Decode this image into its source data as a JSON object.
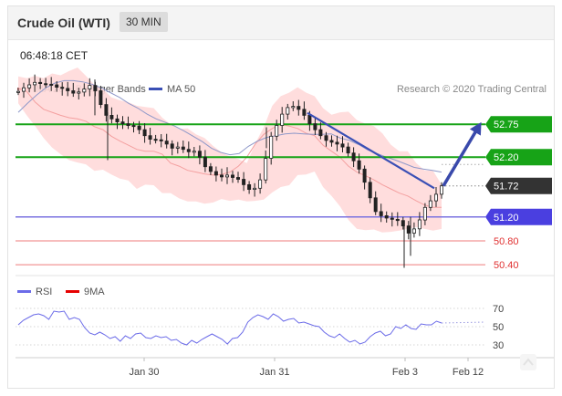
{
  "header": {
    "title": "Crude Oil (WTI)",
    "interval": "30 MIN"
  },
  "timestamp": "06:48:18 CET",
  "legend": {
    "bollinger": "MA 20 + Bollinger Bands",
    "ma50": "MA 50",
    "credit": "Research © 2020 Trading Central",
    "rsi": "RSI",
    "rsi_ma": "9MA"
  },
  "colors": {
    "green": "#17a317",
    "purple": "#4a3fe0",
    "red": "#e64848",
    "navy": "#3a4fb5",
    "band": "#ffd9d9",
    "dark": "#333333"
  },
  "chart_data": [
    {
      "type": "line",
      "title": "Crude Oil (WTI)",
      "x_ticks": [
        "Jan 30",
        "Jan 31",
        "Feb 3",
        "Feb 12"
      ],
      "ylim": [
        50.25,
        53.15
      ],
      "levels": [
        {
          "value": 52.75,
          "label": "52.75",
          "style": "green-line"
        },
        {
          "value": 52.2,
          "label": "52.20",
          "style": "green-line"
        },
        {
          "value": 51.72,
          "label": "51.72",
          "style": "current-price"
        },
        {
          "value": 51.2,
          "label": "51.20",
          "style": "purple-line"
        },
        {
          "value": 50.8,
          "label": "50.80",
          "style": "red-line"
        },
        {
          "value": 50.4,
          "label": "50.40",
          "style": "red-line"
        }
      ],
      "price": [
        53.3,
        53.36,
        53.41,
        53.45,
        53.43,
        53.42,
        53.41,
        53.37,
        53.35,
        53.31,
        53.27,
        53.29,
        53.34,
        53.4,
        53.31,
        53.08,
        52.9,
        52.84,
        52.79,
        52.76,
        52.73,
        52.72,
        52.66,
        52.56,
        52.5,
        52.49,
        52.47,
        52.42,
        52.35,
        52.37,
        52.33,
        52.29,
        52.3,
        52.2,
        52.04,
        51.96,
        51.9,
        51.87,
        51.9,
        51.86,
        51.83,
        51.74,
        51.66,
        51.68,
        51.82,
        52.18,
        52.55,
        52.73,
        52.92,
        53.03,
        53.05,
        53.0,
        52.9,
        52.76,
        52.66,
        52.56,
        52.48,
        52.45,
        52.42,
        52.37,
        52.27,
        52.14,
        52.0,
        51.78,
        51.52,
        51.29,
        51.22,
        51.18,
        51.16,
        51.14,
        51.05,
        50.93,
        51.0,
        51.15,
        51.36,
        51.47,
        51.58,
        51.72
      ],
      "bollinger_upper": [
        53.55,
        53.52,
        53.56,
        53.52,
        53.6,
        53.57,
        53.64,
        53.7,
        53.56,
        53.41,
        53.34,
        53.2,
        53.15,
        53.12,
        53.06,
        53.04,
        53.02,
        52.86,
        52.75,
        52.67,
        52.68,
        52.58,
        52.52,
        52.39,
        52.28,
        52.21,
        52.17,
        52.1,
        52.43,
        52.7,
        53.06,
        53.22,
        53.28,
        53.37,
        53.28,
        53.22,
        53.02,
        52.91,
        52.95,
        52.96,
        52.82,
        52.76,
        52.72,
        52.6,
        52.41,
        52.3,
        52.3,
        52.1,
        51.98,
        51.97,
        51.74
      ],
      "bollinger_lower": [
        53.1,
        52.9,
        52.72,
        52.52,
        52.36,
        52.25,
        52.15,
        52.11,
        52.08,
        51.97,
        51.99,
        51.91,
        51.84,
        51.81,
        51.67,
        51.74,
        51.73,
        51.6,
        51.6,
        51.51,
        51.46,
        51.46,
        51.42,
        51.44,
        51.5,
        51.47,
        51.49,
        51.46,
        51.47,
        51.49,
        51.61,
        51.7,
        51.73,
        51.9,
        51.91,
        51.96,
        51.7,
        51.55,
        51.38,
        51.15,
        51.0,
        50.98,
        50.99,
        50.94,
        50.95,
        50.97,
        51.0,
        51.03,
        51.0,
        50.97,
        51.0
      ],
      "ma20": [
        53.35,
        53.3,
        53.12,
        53.0,
        52.95,
        52.9,
        52.86,
        52.84,
        52.8,
        52.71,
        52.66,
        52.55,
        52.47,
        52.4,
        52.33,
        52.3,
        52.3,
        52.25,
        52.1,
        52.05,
        51.98,
        51.95,
        51.92,
        51.9,
        51.91,
        51.95,
        52.05,
        52.2,
        52.42,
        52.58,
        52.68,
        52.75,
        52.72,
        52.68,
        52.6,
        52.56,
        52.4,
        52.3,
        52.2,
        52.05,
        51.95,
        51.89,
        51.82,
        51.74,
        51.67,
        51.6,
        51.55,
        51.47,
        51.4,
        51.36,
        51.36
      ],
      "ma50": [
        52.95,
        53.1,
        53.24,
        53.36,
        53.44,
        53.48,
        53.48,
        53.46,
        53.42,
        53.36,
        53.28,
        53.2,
        53.1,
        53.02,
        52.92,
        52.84,
        52.78,
        52.72,
        52.64,
        52.55,
        52.46,
        52.35,
        52.28,
        52.24,
        52.26,
        52.38,
        52.47,
        52.53,
        52.56,
        52.59,
        52.6,
        52.59,
        52.58,
        52.58,
        52.59,
        52.52,
        52.48,
        52.41,
        52.32,
        52.26,
        52.2,
        52.15,
        52.09,
        52.03,
        52.0,
        51.98,
        51.95
      ],
      "trendline": [
        {
          "from": 52.94,
          "to": 51.68
        }
      ],
      "projection": [
        {
          "from": 51.72,
          "to": 52.72
        }
      ]
    },
    {
      "type": "line",
      "ylim": [
        18,
        78
      ],
      "y_ticks": [
        70,
        50,
        30
      ],
      "rsi": [
        52,
        57,
        60,
        63,
        64,
        62,
        58,
        67,
        66,
        67,
        58,
        60,
        58,
        49,
        43,
        41,
        44,
        41,
        37,
        39,
        34,
        40,
        37,
        42,
        43,
        38,
        37,
        40,
        38,
        39,
        35,
        36,
        32,
        30,
        35,
        32,
        36,
        39,
        42,
        39,
        36,
        31,
        37,
        38,
        44,
        55,
        60,
        63,
        61,
        58,
        64,
        61,
        56,
        58,
        59,
        54,
        55,
        53,
        51,
        50,
        44,
        40,
        38,
        42,
        37,
        33,
        35,
        31,
        33,
        39,
        43,
        45,
        40,
        42,
        50,
        48,
        52,
        48,
        47,
        53,
        52,
        52,
        56,
        54
      ],
      "rsi_ma_dashed": [
        54,
        55
      ]
    }
  ]
}
